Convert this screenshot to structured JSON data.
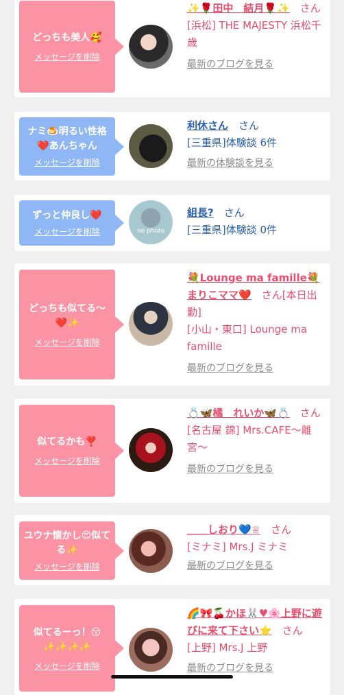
{
  "cards": [
    {
      "message": "どっちも美人🥰",
      "delete_label": "メッセージを削除",
      "name": "✨🌹田中　結月🌹✨",
      "suffix": "さん",
      "place": "[浜松] THE MAJESTY 浜松千歳",
      "link": "最新のブログを見る"
    },
    {
      "message": "ナミ🍮明るい性格❤️あんちゃん",
      "delete_label": "メッセージを削除",
      "name": "利休さん",
      "suffix": "さん",
      "place": "[三重県]体験談 6件",
      "link": "最新の体験談を見る"
    },
    {
      "message": "ずっと仲良し❤️",
      "delete_label": "メッセージを削除",
      "name": "組長?",
      "suffix": "さん",
      "place": "[三重県]体験談 0件",
      "avatar_text": "no photo"
    },
    {
      "message": "どっちも似てる〜❤️✨",
      "delete_label": "メッセージを削除",
      "name": "💐Lounge ma famille💐まりこママ❤️",
      "suffix": "さん",
      "extra": "[本日出勤]",
      "place": "[小山・東口] Lounge ma famille",
      "link": "最新のブログを見る"
    },
    {
      "message": "似てるかも❣️",
      "delete_label": "メッセージを削除",
      "name": "💍🦋橘　れいか🦋💍",
      "suffix": "さん",
      "place": "[名古屋 錦] Mrs.CAFE〜離宮〜",
      "link": "最新のブログを見る"
    },
    {
      "message": "ユウナ懐かし😍似てる✨",
      "delete_label": "メッセージを削除",
      "name": "＿＿しおり💙♕",
      "suffix": "さん",
      "place": "[ミナミ] Mrs.J ミナミ",
      "link": "最新のブログを見る"
    },
    {
      "message": "似てるーっ！😚✨✨✨✨",
      "delete_label": "メッセージを削除",
      "name": "🌈🎀🍒かほ🐰♥🌸上野に遊びに来て下さい⭐️",
      "suffix": "さん",
      "place": "[上野] Mrs.J 上野",
      "link": "最新のブログを見る"
    }
  ],
  "colors": {
    "bubble_pink": "#fb93a5",
    "bubble_blue": "#8fb7f5",
    "cast_name": "#e84d6c",
    "member_name": "#2a5fb0",
    "link_gray": "#8a8a8a"
  }
}
